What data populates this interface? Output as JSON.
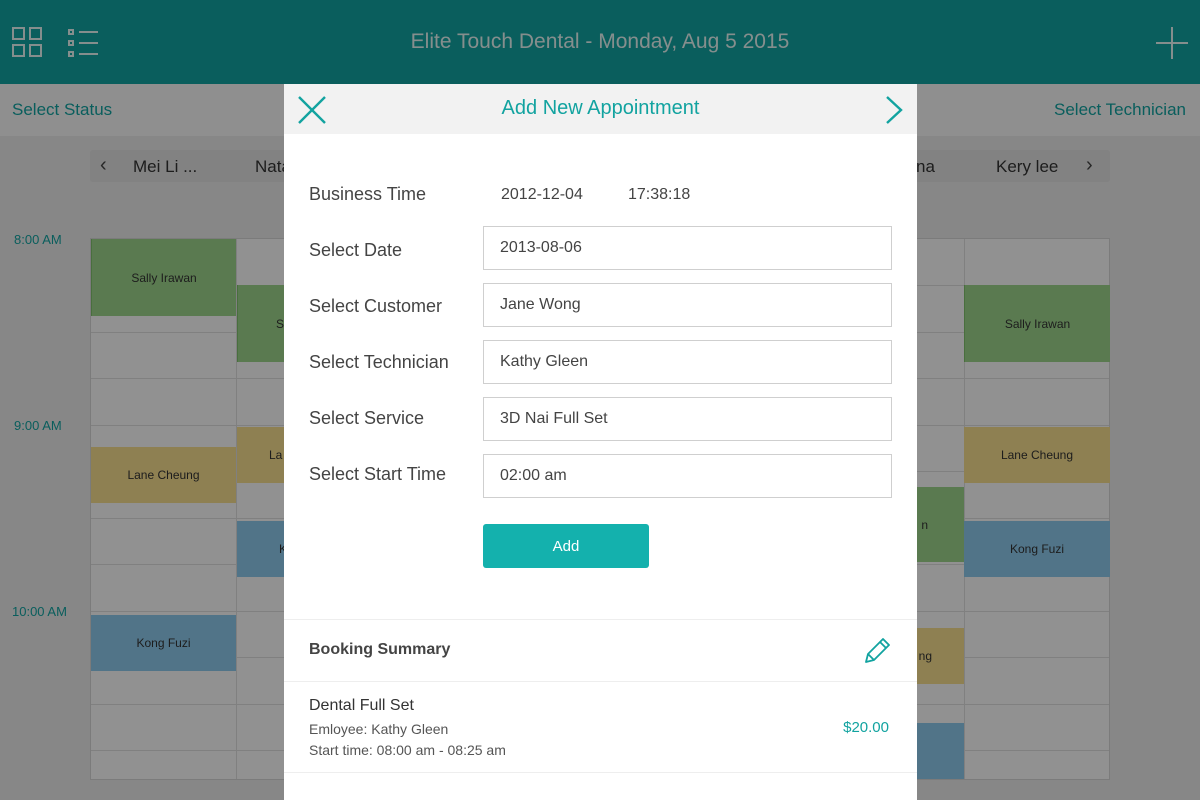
{
  "app": {
    "title": "Elite Touch Dental - Monday, Aug 5 2015"
  },
  "status_bar": {
    "select_status": "Select Status",
    "select_technician": "Select Technician"
  },
  "technicians": {
    "visible_left": [
      "Mei Li ...",
      "Nata"
    ],
    "visible_right": [
      "na",
      "Kery lee"
    ]
  },
  "calendar": {
    "time_labels": [
      "8:00 AM",
      "9:00 AM",
      "10:00 AM"
    ],
    "appointments": [
      {
        "name": "Sally Irawan",
        "color": "green"
      },
      {
        "name": "Sa",
        "color": "green"
      },
      {
        "name": "Sally Irawan",
        "color": "green"
      },
      {
        "name": "Lane Cheung",
        "color": "yellow"
      },
      {
        "name": "La",
        "color": "yellow"
      },
      {
        "name": "Lane Cheung",
        "color": "yellow"
      },
      {
        "name": "K",
        "color": "blue"
      },
      {
        "name": "n",
        "color": "green"
      },
      {
        "name": "Kong Fuzi",
        "color": "blue"
      },
      {
        "name": "Kong Fuzi",
        "color": "blue"
      },
      {
        "name": "ng",
        "color": "yellow"
      },
      {
        "name": "",
        "color": "blue"
      }
    ],
    "colors": {
      "green": "#9cd38a",
      "yellow": "#f4dc8e",
      "blue": "#8cc8ea"
    }
  },
  "modal": {
    "title": "Add New Appointment",
    "icons": {
      "close": "close-icon",
      "next": "chevron-right-icon",
      "edit": "pencil-icon"
    },
    "business_time": {
      "label": "Business Time",
      "date": "2012-12-04",
      "time": "17:38:18"
    },
    "fields": {
      "date": {
        "label": "Select Date",
        "value": "2013-08-06"
      },
      "customer": {
        "label": "Select Customer",
        "value": "Jane Wong"
      },
      "technician": {
        "label": "Select Technician",
        "value": "Kathy Gleen"
      },
      "service": {
        "label": "Select Service",
        "value": "3D Nai Full Set"
      },
      "start_time": {
        "label": "Select Start Time",
        "value": "02:00 am"
      }
    },
    "add_label": "Add",
    "summary": {
      "title": "Booking Summary",
      "item": {
        "name": "Dental Full Set",
        "employee": "Emloyee: Kathy Gleen",
        "time": "Start time: 08:00 am - 08:25 am",
        "price": "$20.00"
      }
    }
  },
  "theme": {
    "accent": "#12a3a0",
    "button": "#14b1ad"
  }
}
